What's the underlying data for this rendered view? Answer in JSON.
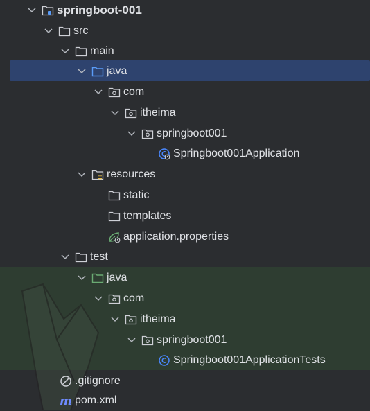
{
  "project_tree": {
    "root": "springboot-001",
    "src": "src",
    "main": "main",
    "main_java": "java",
    "main_com": "com",
    "main_itheima": "itheima",
    "main_springboot001": "springboot001",
    "main_app_class": "Springboot001Application",
    "resources": "resources",
    "static": "static",
    "templates": "templates",
    "app_properties": "application.properties",
    "test": "test",
    "test_java": "java",
    "test_com": "com",
    "test_itheima": "itheima",
    "test_springboot001": "springboot001",
    "test_class": "Springboot001ApplicationTests",
    "gitignore": ".gitignore",
    "pom": "pom.xml"
  },
  "icons": {
    "chevron": "chevron-down-icon",
    "folder": "folder-icon",
    "source_folder": "source-folder-icon",
    "test_folder": "test-source-folder-icon",
    "package": "package-icon",
    "resources_folder": "resources-folder-icon",
    "spring_class": "spring-boot-class-icon",
    "class": "class-icon",
    "properties": "spring-properties-icon",
    "ignore": "ignore-file-icon",
    "maven": "maven-icon"
  },
  "colors": {
    "background": "#2b2d30",
    "selection": "#2e436e",
    "test_band": "#2e3d31",
    "text": "#dfe1e5",
    "source_folder": "#5a9cf8",
    "test_folder": "#6aab73",
    "class_icon": "#4a88ff",
    "maven": "#6f8cff"
  }
}
